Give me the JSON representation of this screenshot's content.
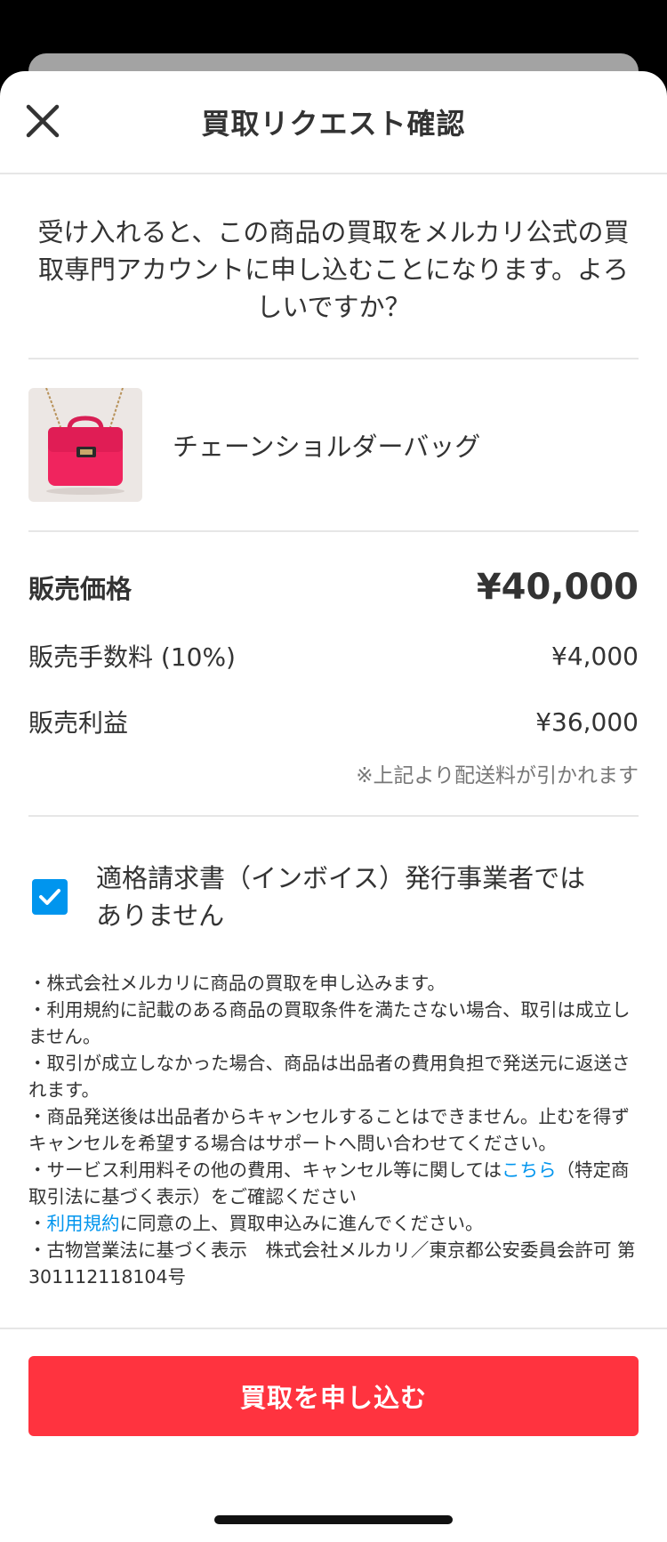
{
  "header": {
    "title": "買取リクエスト確認"
  },
  "intro": {
    "text": "受け入れると、この商品の買取をメルカリ公式の買取専門アカウントに申し込むことになります。よろしいですか？"
  },
  "product": {
    "name": "チェーンショルダーバッグ"
  },
  "prices": {
    "sale_label": "販売価格",
    "sale_value": "¥40,000",
    "fee_label": "販売手数料 (10%)",
    "fee_value": "¥4,000",
    "profit_label": "販売利益",
    "profit_value": "¥36,000",
    "note": "※上記より配送料が引かれます"
  },
  "invoice": {
    "checked": true,
    "label_line1": "適格請求書（インボイス）発行事業者では",
    "label_line2": "ありません"
  },
  "notes": {
    "item1": "・株式会社メルカリに商品の買取を申し込みます。",
    "item2": "・利用規約に記載のある商品の買取条件を満たさない場合、取引は成立しません。",
    "item3": "・取引が成立しなかった場合、商品は出品者の費用負担で発送元に返送されます。",
    "item4": "・商品発送後は出品者からキャンセルすることはできません。止むを得ずキャンセルを希望する場合はサポートへ問い合わせてください。",
    "item5_pre": "・サービス利用料その他の費用、キャンセル等に関しては",
    "item5_link": "こちら",
    "item5_post": "（特定商取引法に基づく表示）をご確認ください",
    "item6_pre": "・",
    "item6_link": "利用規約",
    "item6_post": "に同意の上、買取申込みに進んでください。",
    "item7": "・古物営業法に基づく表示　株式会社メルカリ／東京都公安委員会許可 第301112118104号"
  },
  "footer": {
    "submit_label": "買取を申し込む"
  },
  "colors": {
    "accent_red": "#ff333f",
    "link_blue": "#0095ee",
    "product_bag": "#f0245e"
  }
}
